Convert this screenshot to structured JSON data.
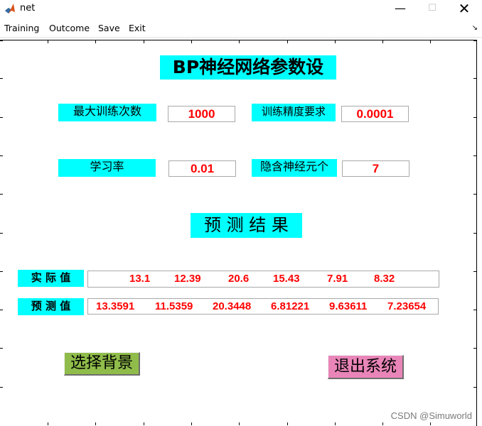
{
  "window": {
    "title": "net"
  },
  "menu": [
    "Training",
    "Outcome",
    "Save",
    "Exit"
  ],
  "params": {
    "heading": "BP神经网络参数设",
    "max_epochs_label": "最大训练次数",
    "max_epochs_value": "1000",
    "goal_label": "训练精度要求",
    "goal_value": "0.0001",
    "lr_label": "学习率",
    "lr_value": "0.01",
    "hidden_label": "隐含神经元个",
    "hidden_value": "7"
  },
  "results": {
    "heading": "预 测 结 果",
    "actual_label": "实 际 值",
    "actual_values": [
      "13.1",
      "12.39",
      "20.6",
      "15.43",
      "7.91",
      "8.32"
    ],
    "predicted_label": "预 测 值",
    "predicted_values": [
      "13.3591",
      "11.5359",
      "20.3448",
      "6.81221",
      "9.63611",
      "7.23654"
    ]
  },
  "buttons": {
    "background": "选择背景",
    "exit": "退出系统"
  },
  "watermark": "CSDN @Simuworld",
  "colors": {
    "label_bg": "#00ffff",
    "value_text": "#ff0000",
    "bg_button": "#8fbc4a",
    "exit_button": "#e985b8"
  },
  "icons": {
    "app": "matlab-icon",
    "minimize": "minimize-icon",
    "maximize": "maximize-icon",
    "close": "close-icon",
    "menu_arrow": "menu-arrow-icon"
  }
}
